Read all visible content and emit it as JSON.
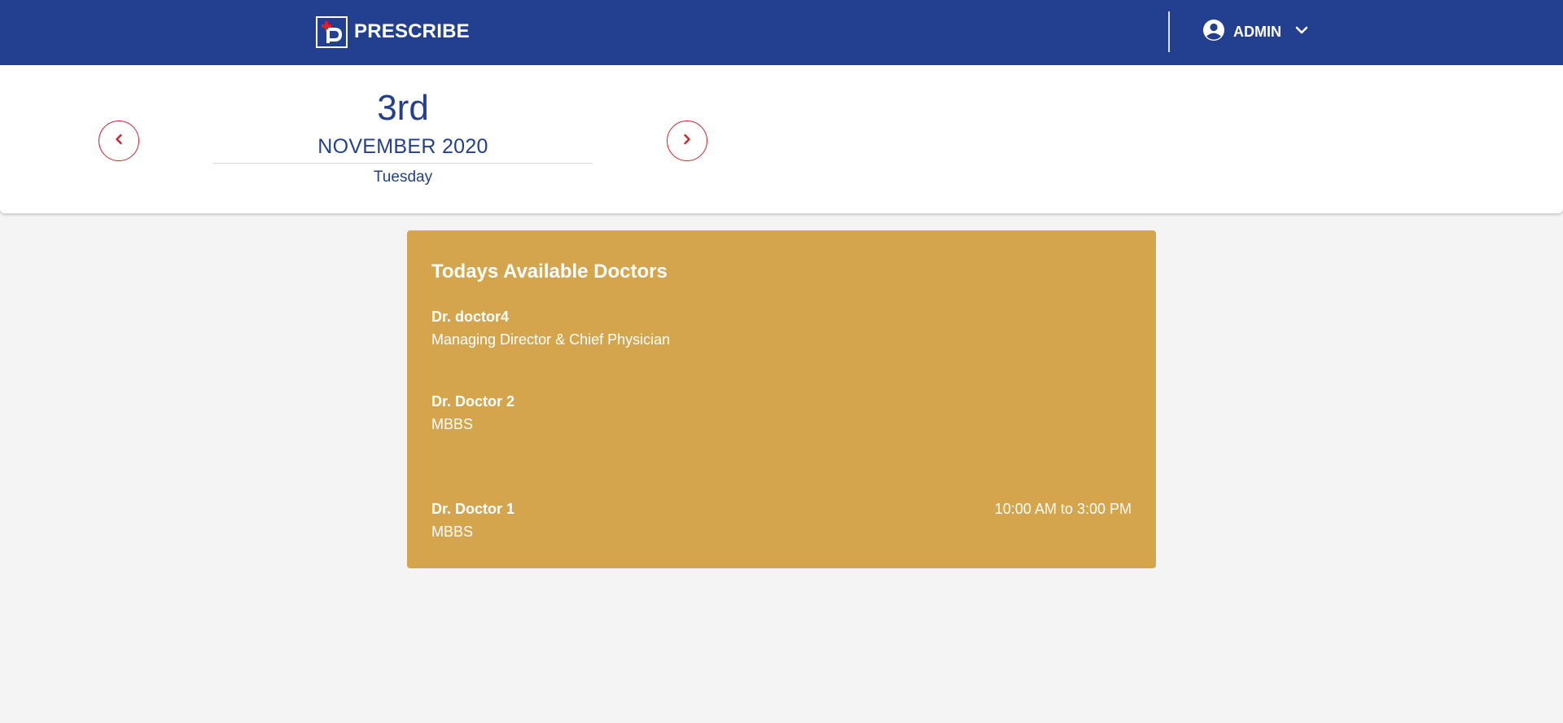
{
  "header": {
    "brand": "PRESCRIBE",
    "user": {
      "name": "ADMIN",
      "icon": "account-circle-icon",
      "dropdown_icon": "chevron-down-icon"
    }
  },
  "date": {
    "day": "3rd",
    "month_year": "NOVEMBER 2020",
    "weekday": "Tuesday",
    "prev_icon": "chevron-left-icon",
    "next_icon": "chevron-right-icon"
  },
  "doctors": {
    "title": "Todays Available Doctors",
    "list": [
      {
        "name": "Dr. doctor4",
        "designation": "Managing Director & Chief Physician",
        "hours": ""
      },
      {
        "name": "Dr. Doctor 2",
        "designation": "MBBS",
        "hours": ""
      },
      {
        "name": "Dr. Doctor 1",
        "designation": "MBBS",
        "hours": "10:00 AM to 3:00 PM"
      }
    ]
  },
  "colors": {
    "header_bg": "#233f8f",
    "accent_red": "#d3222a",
    "card_bg": "#d4a54d",
    "page_bg": "#f4f4f4"
  }
}
